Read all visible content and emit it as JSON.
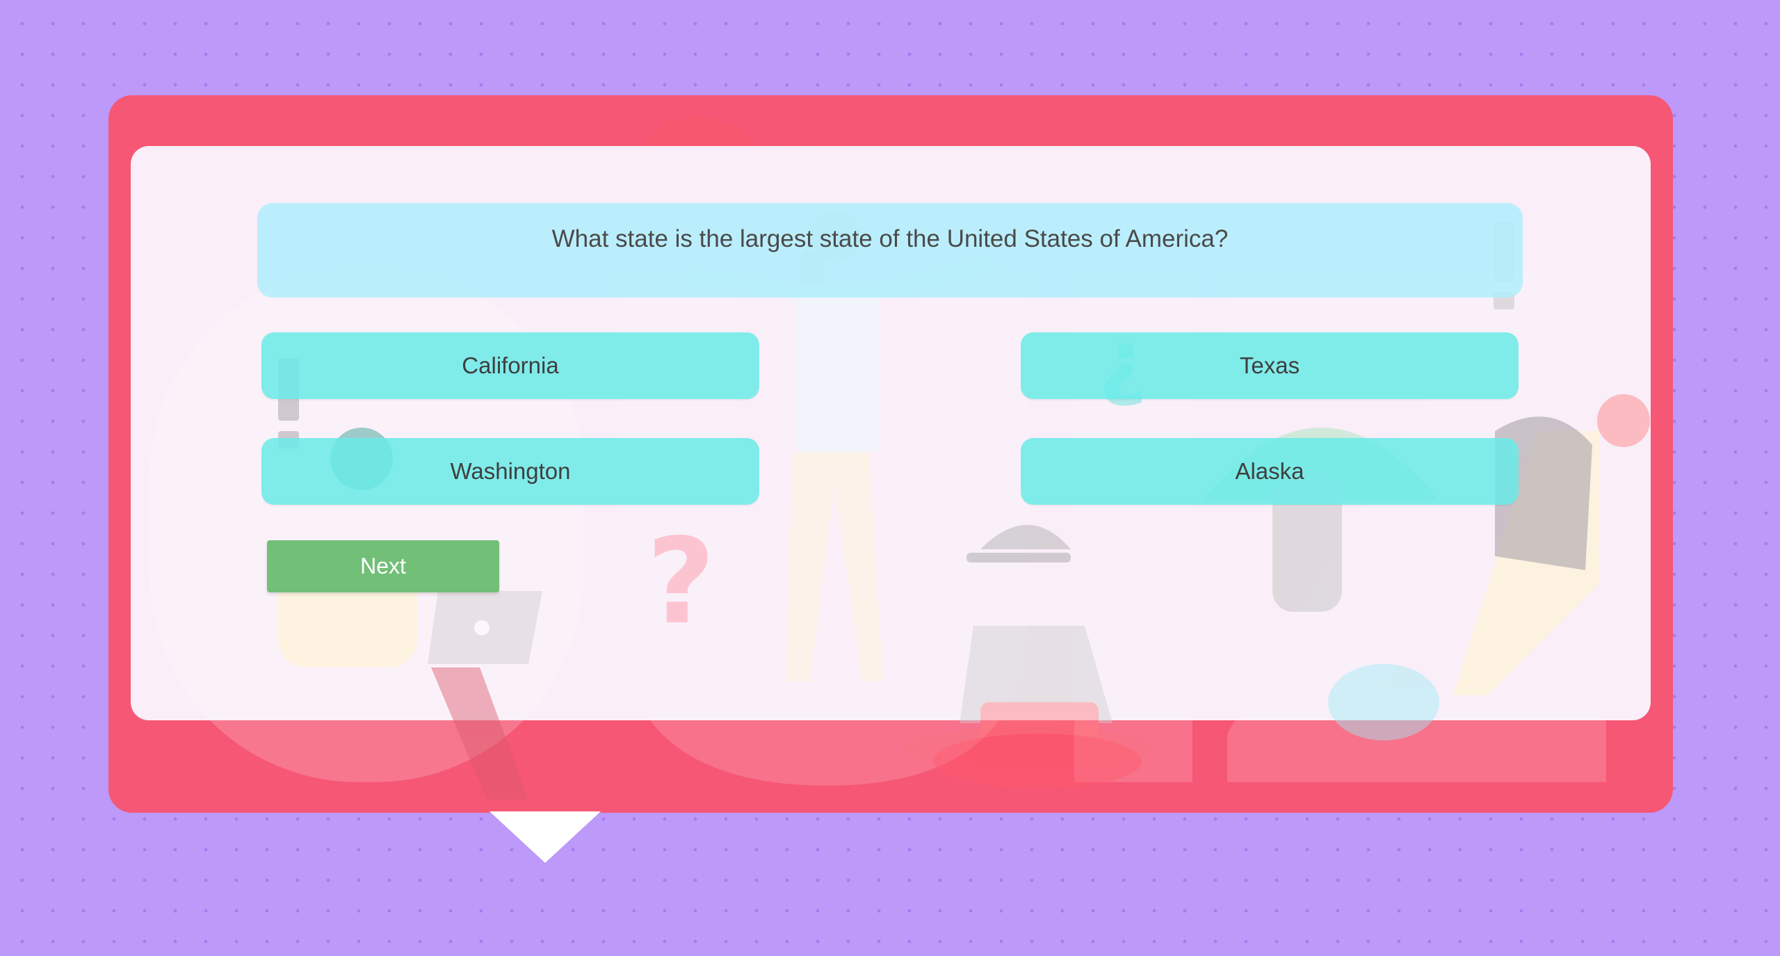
{
  "question": {
    "text": "What state is the largest state of the United States of America?"
  },
  "answers": [
    {
      "label": "California"
    },
    {
      "label": "Texas"
    },
    {
      "label": "Washington"
    },
    {
      "label": "Alaska"
    }
  ],
  "next_button": {
    "label": "Next"
  },
  "colors": {
    "page_background": "#bd99f9",
    "frame": "#fa5269",
    "card": "#faf7ff",
    "question_box": "#b2eefc",
    "answer_button": "#68ebe8",
    "next_button": "#72bf78"
  },
  "background_art": {
    "word": "Quiz",
    "icons": [
      "question-mark-icon",
      "exclamation-icon",
      "inverted-question-icon",
      "laptop-icon",
      "person-illustration"
    ]
  }
}
